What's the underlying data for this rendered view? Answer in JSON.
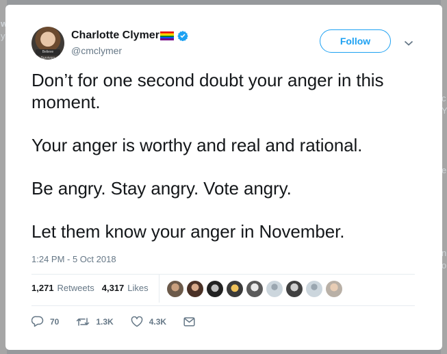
{
  "background": {
    "edge_left_top": "w",
    "edge_left_sub": "y",
    "edge_right": [
      "c",
      "Y",
      "e",
      "n",
      "o"
    ]
  },
  "tweet": {
    "author_name": "Charlotte Clymer",
    "author_handle": "@cmclymer",
    "avatar_caption": "Believe Survivors",
    "follow_label": "Follow",
    "paragraphs": [
      "Don’t for one second doubt your anger in this moment.",
      "Your anger is worthy and real and rational.",
      "Be angry. Stay angry. Vote angry.",
      "Let them know your anger in November."
    ],
    "timestamp": "1:24 PM - 5 Oct 2018",
    "retweets_count": "1,271",
    "retweets_label": "Retweets",
    "likes_count": "4,317",
    "likes_label": "Likes",
    "reply_count": "70",
    "retweet_action_count": "1.3K",
    "like_action_count": "4.3K"
  },
  "colors": {
    "accent": "#1da1f2",
    "text": "#14171a",
    "muted": "#657786",
    "divider": "#e6ecf0",
    "pride_flag": [
      "#e40303",
      "#ff8c00",
      "#ffed00",
      "#008026",
      "#004dff",
      "#750787"
    ]
  },
  "icons": {
    "verified": "verified-badge-icon",
    "caret": "chevron-down-icon",
    "reply": "reply-icon",
    "retweet": "retweet-icon",
    "like": "heart-icon",
    "dm": "envelope-icon"
  }
}
